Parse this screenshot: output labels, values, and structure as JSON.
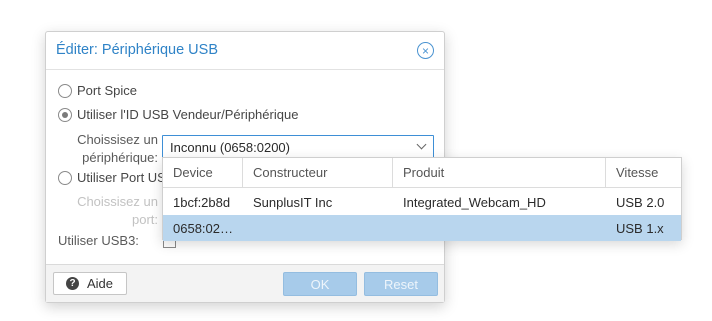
{
  "dialog": {
    "title": "Éditer: Périphérique USB",
    "options": {
      "port_spice": "Port Spice",
      "vendor_device": "Utiliser l'ID USB Vendeur/Périphérique",
      "usb_port": "Utiliser Port US"
    },
    "device_field": {
      "label_line1": "Choissisez un",
      "label_line2": "périphérique:",
      "value": "Inconnu (0658:0200)"
    },
    "port_field": {
      "label_line1": "Choissisez un",
      "label_line2": "port:"
    },
    "usb3_label": "Utiliser USB3:",
    "footer": {
      "help_label": "Aide",
      "ok_label": "OK",
      "reset_label": "Reset"
    }
  },
  "device_list": {
    "columns": [
      "Device",
      "Constructeur",
      "Produit",
      "Vitesse"
    ],
    "rows": [
      {
        "device": "1bcf:2b8d",
        "vendor": "SunplusIT Inc",
        "product": "Integrated_Webcam_HD",
        "speed": "USB 2.0"
      },
      {
        "device": "0658:02…",
        "vendor": "",
        "product": "",
        "speed": "USB 1.x"
      }
    ]
  },
  "colors": {
    "accent": "#2f83c7",
    "selected_row": "#b9d6ee",
    "disabled_button": "#a7cbea"
  },
  "icons": {
    "close": "close-circle-icon",
    "help": "question-circle-icon",
    "dropdown": "chevron-down-icon"
  }
}
